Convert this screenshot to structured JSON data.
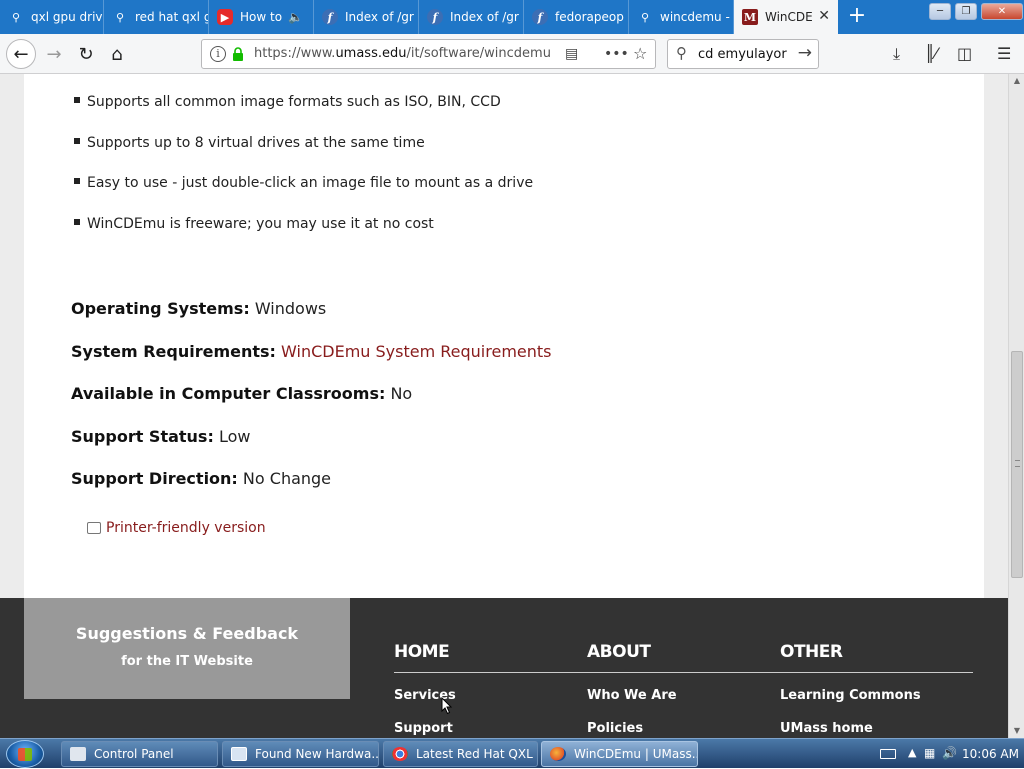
{
  "browser": {
    "tabs": [
      {
        "label": "qxl gpu drive",
        "icon": "search-icon"
      },
      {
        "label": "red hat qxl g",
        "icon": "search-icon"
      },
      {
        "label": "How to",
        "icon": "youtube-icon"
      },
      {
        "label": "Index of /gr",
        "icon": "fedora-icon"
      },
      {
        "label": "Index of /gr",
        "icon": "fedora-icon"
      },
      {
        "label": "fedorapeop",
        "icon": "fedora-icon"
      },
      {
        "label": "wincdemu -",
        "icon": "search-icon"
      },
      {
        "label": "WinCDE",
        "icon": "umass-icon",
        "active": true
      }
    ],
    "url_prefix": "https://www.",
    "url_domain": "umass.edu",
    "url_path": "/it/software/wincdemu",
    "search_value": "cd emyulayor"
  },
  "page": {
    "bullets": [
      "Supports all common image formats such as ISO, BIN, CCD",
      "Supports up to 8 virtual drives at the same time",
      "Easy to use - just double-click an image file to mount as a drive",
      "WinCDEmu is freeware; you may use it at no cost"
    ],
    "fields": {
      "os_key": "Operating Systems:",
      "os_val": "Windows",
      "req_key": "System Requirements:",
      "req_val": "WinCDEmu System Requirements",
      "class_key": "Available in Computer Classrooms:",
      "class_val": "No",
      "status_key": "Support Status:",
      "status_val": "Low",
      "dir_key": "Support Direction:",
      "dir_val": "No Change"
    },
    "printer_link": "Printer-friendly version"
  },
  "footer": {
    "feedback_title": "Suggestions & Feedback",
    "feedback_sub": "for the IT Website",
    "columns": [
      {
        "heading": "HOME",
        "links": [
          "Services",
          "Support"
        ]
      },
      {
        "heading": "ABOUT",
        "links": [
          "Who We Are",
          "Policies"
        ]
      },
      {
        "heading": "OTHER",
        "links": [
          "Learning Commons",
          "UMass home"
        ]
      }
    ]
  },
  "taskbar": {
    "buttons": [
      {
        "label": "Control Panel"
      },
      {
        "label": "Found New Hardwa..."
      },
      {
        "label": "Latest Red Hat QXL ..."
      },
      {
        "label": "WinCDEmu | UMass...",
        "active": true
      }
    ],
    "clock": "10:06 AM"
  },
  "colors": {
    "tab_strip": "#1f76c7",
    "umass_maroon": "#881c1c",
    "footer_bg": "#333333",
    "feedback_bg": "#999999"
  }
}
